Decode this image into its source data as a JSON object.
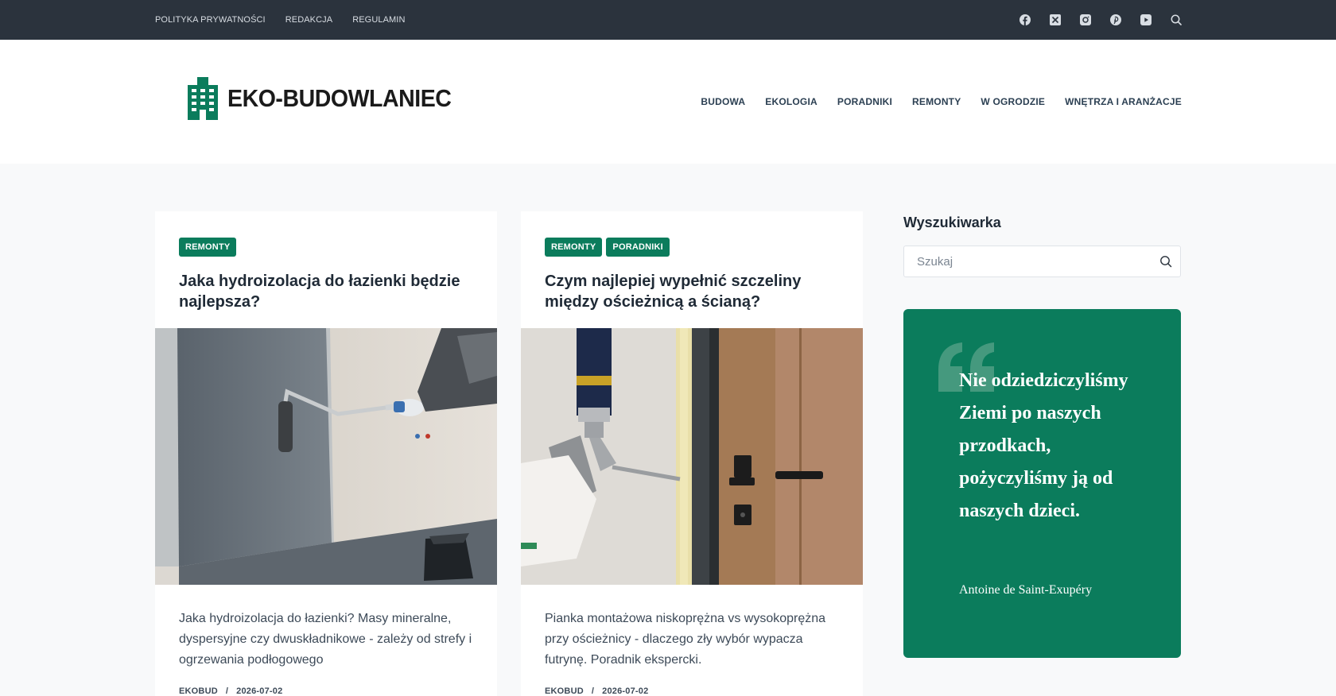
{
  "topbar": {
    "links": [
      "POLITYKA PRYWATNOŚCI",
      "REDAKCJA",
      "REGULAMIN"
    ],
    "social_icons": [
      "facebook-icon",
      "x-twitter-icon",
      "instagram-icon",
      "pinterest-icon",
      "youtube-icon",
      "search-icon"
    ]
  },
  "header": {
    "logo_text": "EKO-BUDOWLANIEC",
    "nav": [
      "BUDOWA",
      "EKOLOGIA",
      "PORADNIKI",
      "REMONTY",
      "W OGRODZIE",
      "WNĘTRZA I ARANŻACJE"
    ]
  },
  "posts": [
    {
      "tags": [
        "REMONTY"
      ],
      "title": "Jaka hydroizolacja do łazienki będzie najlepsza?",
      "excerpt": "Jaka hydroizolacja do łazienki? Masy mineralne, dyspersyjne czy dwuskładnikowe - zależy od strefy i ogrzewania podłogowego",
      "author": "EKOBUD",
      "separator": "/",
      "date": "2026-07-02"
    },
    {
      "tags": [
        "REMONTY",
        "PORADNIKI"
      ],
      "title": "Czym najlepiej wypełnić szczeliny między ościeżnicą a ścianą?",
      "excerpt": "Pianka montażowa niskoprężna vs wysokoprężna przy ościeżnicy - dlaczego zły wybór wypacza futrynę. Poradnik ekspercki.",
      "author": "EKOBUD",
      "separator": "/",
      "date": "2026-07-02"
    }
  ],
  "sidebar": {
    "search_title": "Wyszukiwarka",
    "search_placeholder": "Szukaj",
    "quote_text": "Nie odziedziczyliśmy Ziemi po naszych przodkach, pożyczyliśmy ją od naszych dzieci.",
    "quote_author": "Antoine de Saint-Exupéry"
  },
  "colors": {
    "topbar": "#2b333d",
    "accent": "#0b7c5c",
    "background": "#f8f9fa"
  }
}
